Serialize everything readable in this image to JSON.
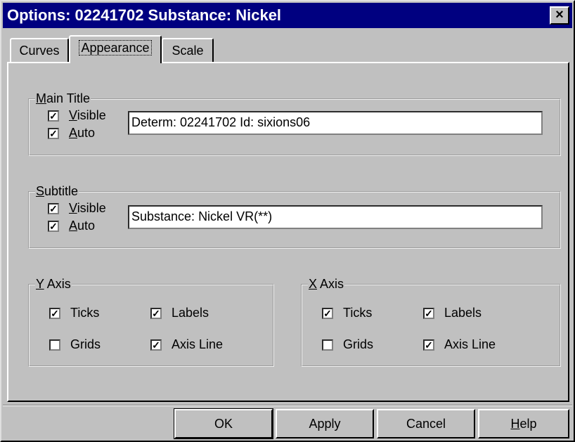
{
  "window": {
    "title": "Options: 02241702 Substance: Nickel",
    "close_glyph": "×"
  },
  "tabs": [
    {
      "label": "Curves",
      "active": false
    },
    {
      "label": "Appearance",
      "active": true
    },
    {
      "label": "Scale",
      "active": false
    }
  ],
  "main_title": {
    "group_label_mnemonic": "M",
    "group_label_rest": "ain Title",
    "visible": {
      "mnemonic": "V",
      "rest": "isible",
      "checked": true
    },
    "auto": {
      "mnemonic": "A",
      "rest": "uto",
      "checked": true
    },
    "value": "Determ: 02241702 Id: sixions06"
  },
  "subtitle": {
    "group_label_mnemonic": "S",
    "group_label_rest": "ubtitle",
    "visible": {
      "mnemonic": "V",
      "rest": "isible",
      "checked": true
    },
    "auto": {
      "mnemonic": "A",
      "rest": "uto",
      "checked": true
    },
    "value": "Substance: Nickel VR(**)"
  },
  "y_axis": {
    "group_label_mnemonic": "Y",
    "group_label_rest": " Axis",
    "ticks": {
      "label": "Ticks",
      "checked": true
    },
    "labels": {
      "label": "Labels",
      "checked": true
    },
    "grids": {
      "label": "Grids",
      "checked": false
    },
    "axis_line": {
      "label": "Axis Line",
      "checked": true
    }
  },
  "x_axis": {
    "group_label_mnemonic": "X",
    "group_label_rest": " Axis",
    "ticks": {
      "label": "Ticks",
      "checked": true
    },
    "labels": {
      "label": "Labels",
      "checked": true
    },
    "grids": {
      "label": "Grids",
      "checked": false
    },
    "axis_line": {
      "label": "Axis Line",
      "checked": true
    }
  },
  "buttons": {
    "ok": "OK",
    "apply": "Apply",
    "cancel": "Cancel",
    "help_mnemonic": "H",
    "help_rest": "elp"
  },
  "check_glyph": "✓"
}
